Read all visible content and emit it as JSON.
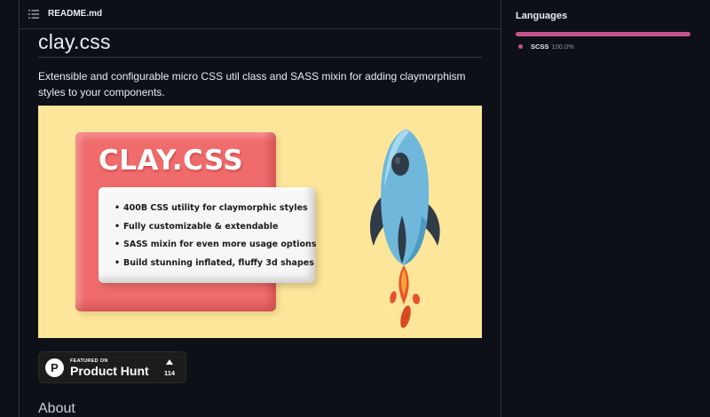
{
  "readme": {
    "filename": "README.md",
    "title": "clay.css",
    "description": "Extensible and configurable micro CSS util class and SASS mixin for adding claymorphism styles to your components."
  },
  "banner": {
    "title": "CLAY.CSS",
    "bullet": "•",
    "features": [
      "400B CSS utility for claymorphic styles",
      "Fully customizable & extendable",
      "SASS mixin for even more usage options",
      "Build stunning inflated, fluffy 3d shapes"
    ],
    "colors": {
      "background": "#fde69a",
      "card": "#f06c6c",
      "rocket_body": "#6fb8dc"
    }
  },
  "product_hunt": {
    "featured_on": "FEATURED ON",
    "name": "Product Hunt",
    "upvotes": "114"
  },
  "about": {
    "heading": "About"
  },
  "sidebar": {
    "languages_heading": "Languages",
    "languages": [
      {
        "name": "SCSS",
        "percent_label": "100.0%",
        "percent": 100,
        "color": "#c6538c"
      }
    ]
  },
  "icons": {
    "readme_list": "list-icon",
    "product_hunt": "product-hunt-logo-icon",
    "upvote": "upvote-triangle-icon",
    "rocket": "rocket-illustration"
  }
}
